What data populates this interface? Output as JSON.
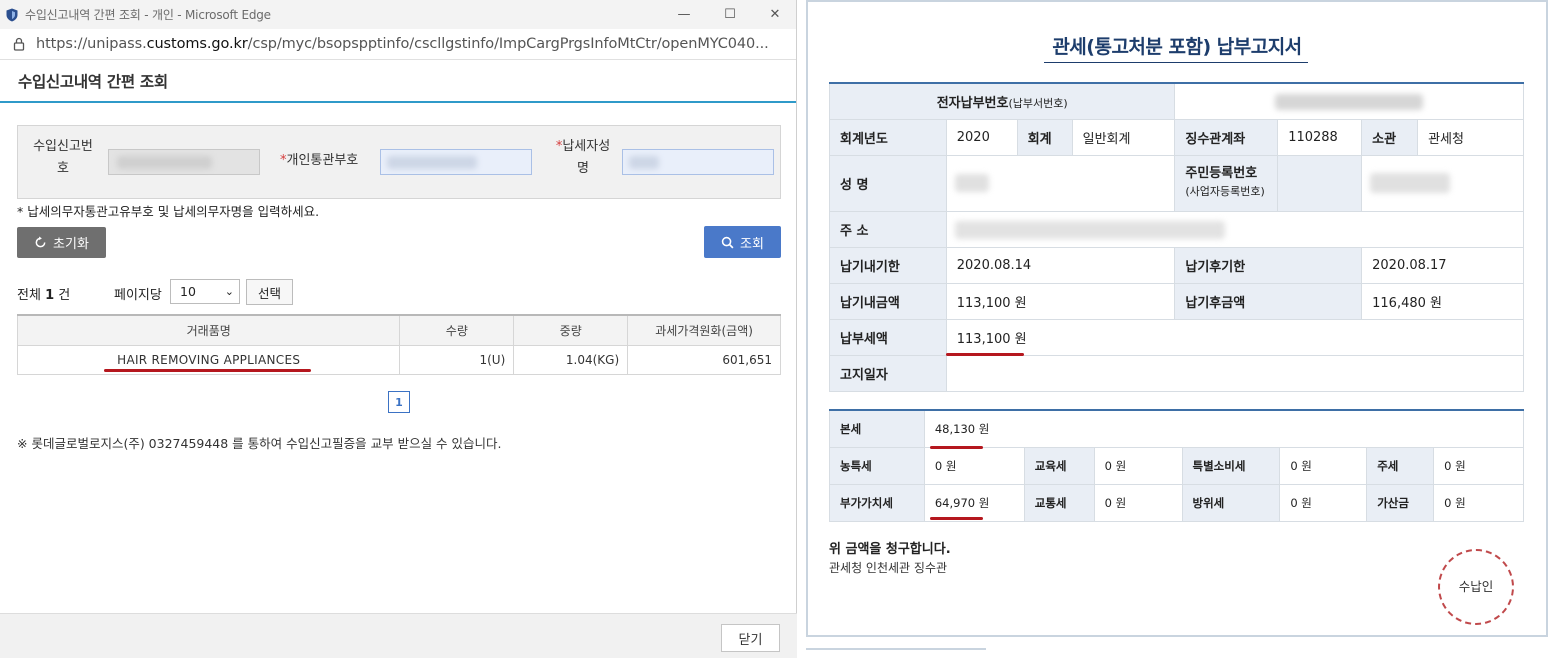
{
  "window": {
    "title": "수입신고내역 간편 조회 - 개인 - Microsoft Edge",
    "url_prefix": "https://unipass.",
    "url_domain": "customs.go.kr",
    "url_path": "/csp/myc/bsopspptinfo/cscllgstinfo/ImpCargPrgsInfoMtCtr/openMYC040...",
    "controls": {
      "minimize": "—",
      "maximize": "☐",
      "close": "✕"
    }
  },
  "page": {
    "title": "수입신고내역 간편 조회"
  },
  "search": {
    "decl_no_label_1": "수입신고번",
    "decl_no_label_2": "호",
    "customs_code_req": "*",
    "customs_code_label": "개인통관부호",
    "taxpayer_req": "*",
    "taxpayer_label_1": "납세자성",
    "taxpayer_label_2": "명",
    "note": "* 납세의무자통관고유부호 및 납세의무자명을 입력하세요.",
    "reset_label": "초기화",
    "search_label": "조회"
  },
  "results": {
    "count_prefix": "전체 ",
    "count_value": "1",
    "count_suffix": " 건",
    "per_page_label": "페이지당",
    "per_page_value": "10",
    "select_label": "선택",
    "columns": [
      "거래품명",
      "수량",
      "중량",
      "과세가격원화(금액)"
    ],
    "rows": [
      [
        "HAIR REMOVING APPLIANCES",
        "1(U)",
        "1.04(KG)",
        "601,651"
      ]
    ],
    "page": "1",
    "footnote": "※ 롯데글로벌로지스(주) 0327459448 를 통하여 수입신고필증을 교부 받으실 수 있습니다.",
    "close_label": "닫기"
  },
  "notice": {
    "title": "관세(통고처분 포함) 납부고지서",
    "epay_label": "전자납부번호",
    "epay_sub": "(납부서번호)",
    "fiscal_year_label": "회계년도",
    "fiscal_year": "2020",
    "account_label": "회계",
    "account": "일반회계",
    "collect_account_label": "징수관계좌",
    "collect_account": "110288",
    "jurisdiction_label": "소관",
    "jurisdiction": "관세청",
    "name_label": "성 명",
    "resident_no_label": "주민등록번호",
    "resident_no_sub": "(사업자등록번호)",
    "address_label": "주 소",
    "due_in_label": "납기내기한",
    "due_in": "2020.08.14",
    "due_after_label": "납기후기한",
    "due_after": "2020.08.17",
    "amt_in_label": "납기내금액",
    "amt_in": "113,100 원",
    "amt_after_label": "납기후금액",
    "amt_after": "116,480 원",
    "pay_tax_label": "납부세액",
    "pay_tax": "113,100 원",
    "notice_date_label": "고지일자",
    "bonse_label": "본세",
    "bonse": "48,130 원",
    "nongteuk_label": "농특세",
    "nongteuk": "0 원",
    "edu_label": "교육세",
    "edu": "0 원",
    "special_label": "특별소비세",
    "special": "0 원",
    "liquor_label": "주세",
    "liquor": "0 원",
    "vat_label": "부가가치세",
    "vat": "64,970 원",
    "traffic_label": "교통세",
    "traffic": "0 원",
    "defense_label": "방위세",
    "defense": "0 원",
    "penalty_label": "가산금",
    "penalty": "0 원",
    "claim_text": "위 금액을 청구합니다.",
    "issuer": "관세청 인천세관 징수관",
    "stamp_label": "수납인"
  },
  "colors": {
    "accent_blue": "#4a79c9",
    "header_line": "#2f9ac9",
    "annotation_red": "#b5171e",
    "notice_navy": "#1d3d6c"
  }
}
